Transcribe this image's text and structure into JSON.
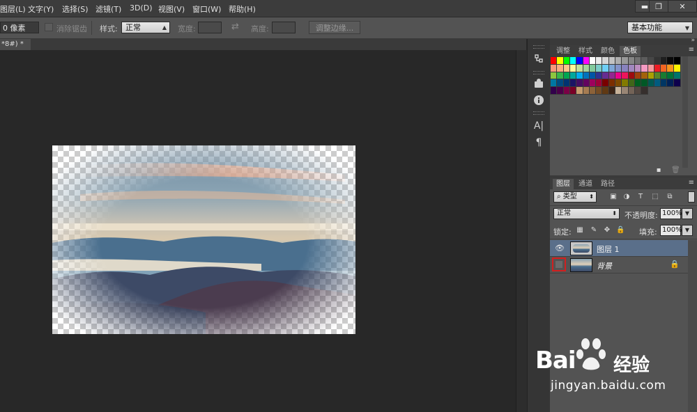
{
  "menubar": {
    "items": [
      "图层(L)",
      "文字(Y)",
      "选择(S)",
      "滤镜(T)",
      "3D(D)",
      "视图(V)",
      "窗口(W)",
      "帮助(H)"
    ],
    "window_buttons": [
      "▬",
      "❐",
      "✕"
    ]
  },
  "options": {
    "feather_value": "0 像素",
    "antialias_label": "消除锯齿",
    "style_label": "样式:",
    "style_value": "正常",
    "width_label": "宽度:",
    "height_label": "高度:",
    "refine_edge_label": "调整边缘...",
    "workspace_value": "基本功能"
  },
  "document": {
    "tab_label": "*8#) *",
    "close_glyph": "×"
  },
  "upper_panel": {
    "tabs": [
      "调整",
      "样式",
      "颜色",
      "色板"
    ],
    "active_tab": "色板"
  },
  "swatch_colors": [
    [
      "#ff0000",
      "#ffff00",
      "#00ff00",
      "#00ffff",
      "#0000ff",
      "#ff00ff",
      "#ffffff",
      "#ebebeb",
      "#d6d6d6",
      "#c2c2c2",
      "#adadad",
      "#999999",
      "#858585",
      "#707070",
      "#5c5c5c",
      "#474747",
      "#333333",
      "#1f1f1f",
      "#0a0a0a",
      "#000000"
    ],
    [
      "#f7977a",
      "#f9ad81",
      "#fdc68a",
      "#fff79a",
      "#c4df9b",
      "#a3d39c",
      "#82ca9d",
      "#7bcdc8",
      "#6ecff6",
      "#7ea7d8",
      "#8493ca",
      "#8882be",
      "#a187be",
      "#bc8dbf",
      "#f49ac2",
      "#f6989d",
      "#ed1c24",
      "#f26522",
      "#f7941d",
      "#fff200"
    ],
    [
      "#8dc63f",
      "#39b54a",
      "#00a651",
      "#00a99d",
      "#00aeef",
      "#0072bc",
      "#0054a6",
      "#2e3192",
      "#662d91",
      "#92278f",
      "#ec008c",
      "#ed145b",
      "#9e0b0f",
      "#a0410d",
      "#a3620a",
      "#aba000",
      "#598527",
      "#197b30",
      "#007236",
      "#00746b"
    ],
    [
      "#0076a3",
      "#004a80",
      "#003471",
      "#1b1464",
      "#440e62",
      "#630460",
      "#9e005d",
      "#9e0039",
      "#790000",
      "#7b2e00",
      "#7d4900",
      "#827b00",
      "#406618",
      "#005e20",
      "#005826",
      "#005952",
      "#005b7f",
      "#003663",
      "#002157",
      "#0d004c"
    ],
    [
      "#32004b",
      "#4b0049",
      "#7b0046",
      "#7a0026",
      "#c69c6e",
      "#a67c52",
      "#8c6239",
      "#754c24",
      "#603913",
      "#3c2415",
      "#c7b299",
      "#998675",
      "#736357",
      "#534741",
      "#362f2d",
      "#d0a58d",
      "#b58a6d",
      "#9b7257",
      "#7d5a42",
      "#5f4231"
    ]
  ],
  "layers_panel": {
    "tabs": [
      "图层",
      "通道",
      "路径"
    ],
    "active_tab": "图层",
    "filter_kind": "类型",
    "blend_mode": "正常",
    "opacity_label": "不透明度:",
    "opacity_value": "100%",
    "lock_label": "锁定:",
    "fill_label": "填充:",
    "fill_value": "100%",
    "layers": [
      {
        "name": "图层 1",
        "visible": true,
        "selected": true
      },
      {
        "name": "背景",
        "visible": false,
        "selected": false,
        "locked": true
      }
    ]
  },
  "watermark": {
    "brand_latin": "Bai",
    "brand_cn": "经验",
    "url": "jingyan.baidu.com"
  },
  "tool_icons": [
    "history-icon",
    "clone-source-icon",
    "info-icon",
    "character-icon",
    "paragraph-icon"
  ]
}
